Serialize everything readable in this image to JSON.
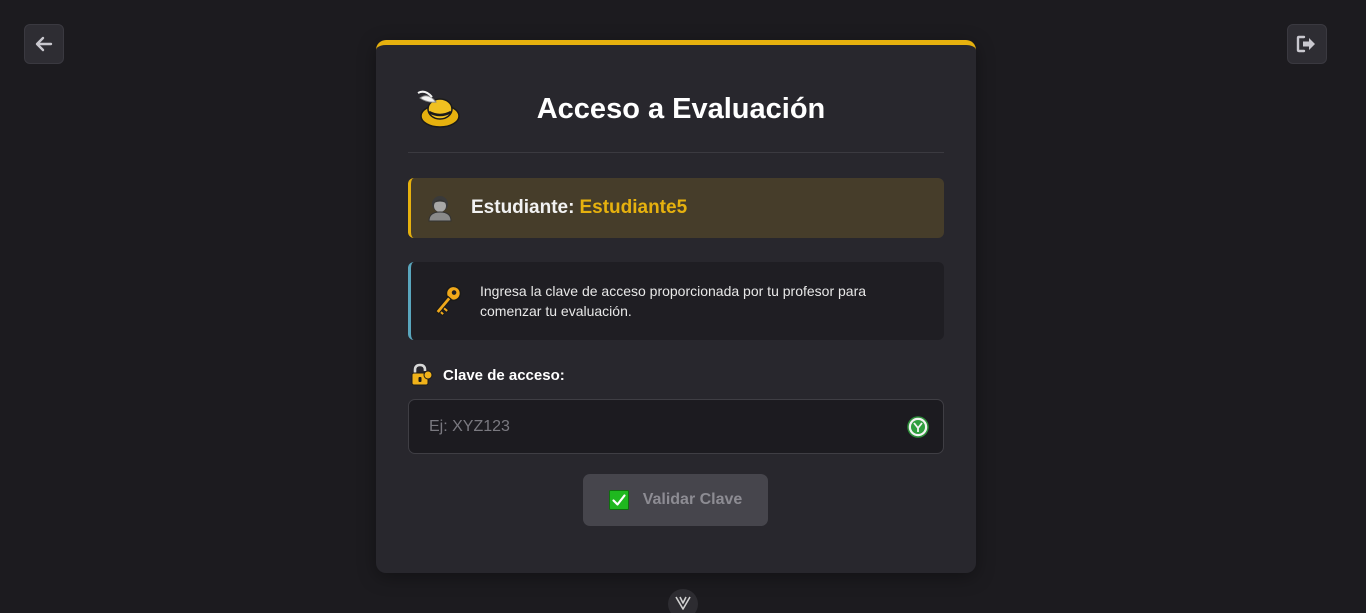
{
  "nav": {
    "back_icon": "arrow-left-icon",
    "logout_icon": "logout-icon"
  },
  "card": {
    "accent_color": "#e6b10e",
    "logo_icon": "yellow-hat-icon",
    "title": "Acceso a Evaluación"
  },
  "student": {
    "icon": "student-icon",
    "label": "Estudiante:",
    "name": "Estudiante5"
  },
  "info": {
    "icon": "key-icon",
    "text": "Ingresa la clave de acceso proporcionada por tu profesor para comenzar tu evaluación."
  },
  "field": {
    "icon": "lock-icon",
    "label": "Clave de acceso:",
    "value": "",
    "placeholder": "Ej: XYZ123",
    "toggle_icon": "eye-toggle-icon"
  },
  "submit": {
    "icon": "check-icon",
    "label": "Validar Clave"
  },
  "bottom_badge_icon": "v-logo-icon"
}
